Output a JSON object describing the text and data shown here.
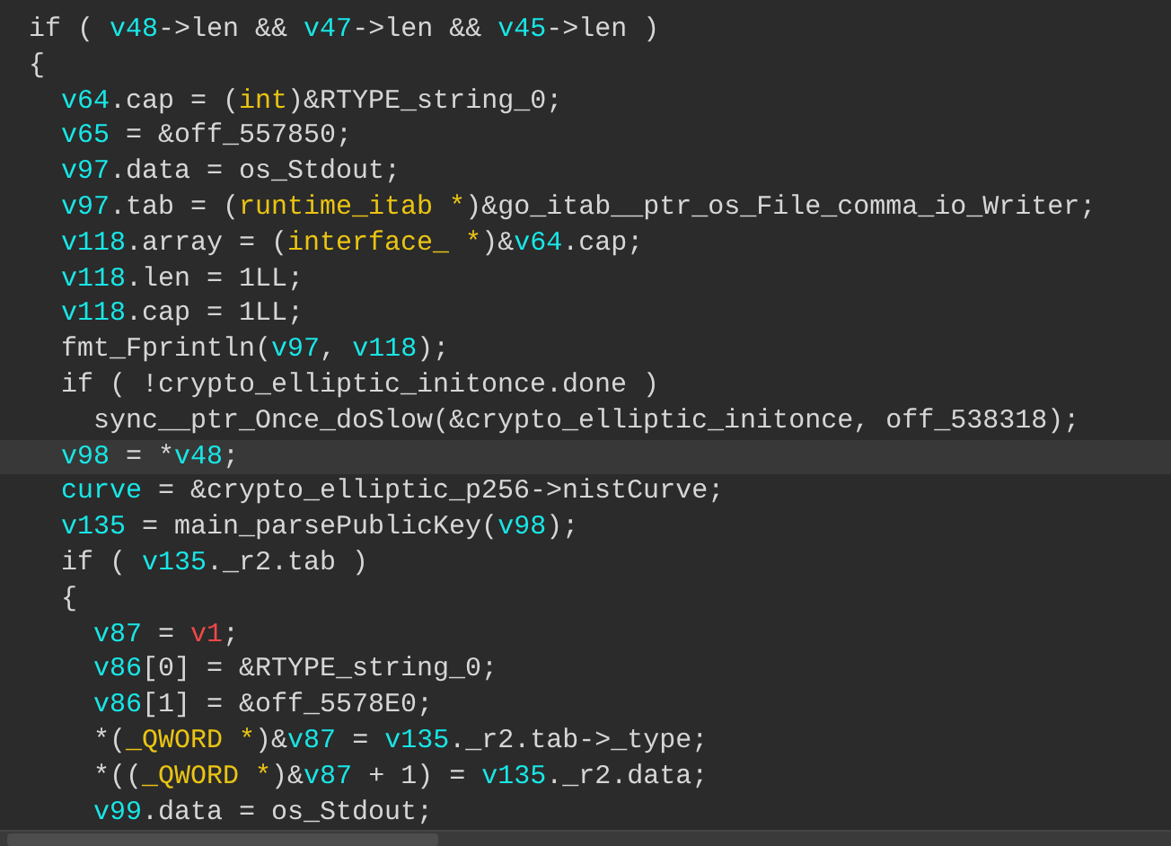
{
  "code_lines": [
    {
      "selected": false,
      "tokens": [
        {
          "text": "if ( ",
          "kind": "plain"
        },
        {
          "text": "v48",
          "kind": "var"
        },
        {
          "text": "->len && ",
          "kind": "plain"
        },
        {
          "text": "v47",
          "kind": "var"
        },
        {
          "text": "->len && ",
          "kind": "plain"
        },
        {
          "text": "v45",
          "kind": "var"
        },
        {
          "text": "->len )",
          "kind": "plain"
        }
      ]
    },
    {
      "selected": false,
      "tokens": [
        {
          "text": "{",
          "kind": "plain"
        }
      ],
      "children": [
        {
          "selected": false,
          "tokens": [
            {
              "text": "v64",
              "kind": "var"
            },
            {
              "text": ".cap = (",
              "kind": "plain"
            },
            {
              "text": "int",
              "kind": "type"
            },
            {
              "text": ")&RTYPE_string_0;",
              "kind": "plain"
            }
          ]
        },
        {
          "selected": false,
          "tokens": [
            {
              "text": "v65",
              "kind": "var"
            },
            {
              "text": " = &off_557850;",
              "kind": "plain"
            }
          ]
        },
        {
          "selected": false,
          "tokens": [
            {
              "text": "v97",
              "kind": "var"
            },
            {
              "text": ".data = os_Stdout;",
              "kind": "plain"
            }
          ]
        },
        {
          "selected": false,
          "tokens": [
            {
              "text": "v97",
              "kind": "var"
            },
            {
              "text": ".tab = (",
              "kind": "plain"
            },
            {
              "text": "runtime_itab *",
              "kind": "type"
            },
            {
              "text": ")&go_itab__ptr_os_File_comma_io_Writer;",
              "kind": "plain"
            }
          ]
        },
        {
          "selected": false,
          "tokens": [
            {
              "text": "v118",
              "kind": "var"
            },
            {
              "text": ".array = (",
              "kind": "plain"
            },
            {
              "text": "interface_ *",
              "kind": "type"
            },
            {
              "text": ")&",
              "kind": "plain"
            },
            {
              "text": "v64",
              "kind": "var"
            },
            {
              "text": ".cap;",
              "kind": "plain"
            }
          ]
        },
        {
          "selected": false,
          "tokens": [
            {
              "text": "v118",
              "kind": "var"
            },
            {
              "text": ".len = 1LL;",
              "kind": "plain"
            }
          ]
        },
        {
          "selected": false,
          "tokens": [
            {
              "text": "v118",
              "kind": "var"
            },
            {
              "text": ".cap = 1LL;",
              "kind": "plain"
            }
          ]
        },
        {
          "selected": false,
          "tokens": [
            {
              "text": "fmt_Fprintln(",
              "kind": "plain"
            },
            {
              "text": "v97",
              "kind": "var"
            },
            {
              "text": ", ",
              "kind": "plain"
            },
            {
              "text": "v118",
              "kind": "var"
            },
            {
              "text": ");",
              "kind": "plain"
            }
          ]
        },
        {
          "selected": false,
          "tokens": [
            {
              "text": "if ( !crypto_elliptic_initonce.done )",
              "kind": "plain"
            }
          ],
          "children": [
            {
              "selected": false,
              "tokens": [
                {
                  "text": "sync__ptr_Once_doSlow(&crypto_elliptic_initonce, off_538318);",
                  "kind": "plain"
                }
              ]
            }
          ]
        },
        {
          "selected": true,
          "tokens": [
            {
              "text": "v98",
              "kind": "var"
            },
            {
              "text": " = *",
              "kind": "plain"
            },
            {
              "text": "v48",
              "kind": "var"
            },
            {
              "text": ";",
              "kind": "plain"
            }
          ]
        },
        {
          "selected": false,
          "tokens": [
            {
              "text": "curve",
              "kind": "var"
            },
            {
              "text": " = &crypto_elliptic_p256->nistCurve;",
              "kind": "plain"
            }
          ]
        },
        {
          "selected": false,
          "tokens": [
            {
              "text": "v135",
              "kind": "var"
            },
            {
              "text": " = main_parsePublicKey(",
              "kind": "plain"
            },
            {
              "text": "v98",
              "kind": "var"
            },
            {
              "text": ");",
              "kind": "plain"
            }
          ]
        },
        {
          "selected": false,
          "tokens": [
            {
              "text": "if ( ",
              "kind": "plain"
            },
            {
              "text": "v135",
              "kind": "var"
            },
            {
              "text": "._r2.tab )",
              "kind": "plain"
            }
          ]
        },
        {
          "selected": false,
          "tokens": [
            {
              "text": "{",
              "kind": "plain"
            }
          ],
          "children": [
            {
              "selected": false,
              "tokens": [
                {
                  "text": "v87",
                  "kind": "var"
                },
                {
                  "text": " = ",
                  "kind": "plain"
                },
                {
                  "text": "v1",
                  "kind": "red"
                },
                {
                  "text": ";",
                  "kind": "plain"
                }
              ]
            },
            {
              "selected": false,
              "tokens": [
                {
                  "text": "v86",
                  "kind": "var"
                },
                {
                  "text": "[0] = &RTYPE_string_0;",
                  "kind": "plain"
                }
              ]
            },
            {
              "selected": false,
              "tokens": [
                {
                  "text": "v86",
                  "kind": "var"
                },
                {
                  "text": "[1] = &off_5578E0;",
                  "kind": "plain"
                }
              ]
            },
            {
              "selected": false,
              "tokens": [
                {
                  "text": "*(",
                  "kind": "plain"
                },
                {
                  "text": "_QWORD *",
                  "kind": "type"
                },
                {
                  "text": ")&",
                  "kind": "plain"
                },
                {
                  "text": "v87",
                  "kind": "var"
                },
                {
                  "text": " = ",
                  "kind": "plain"
                },
                {
                  "text": "v135",
                  "kind": "var"
                },
                {
                  "text": "._r2.tab->_type;",
                  "kind": "plain"
                }
              ]
            },
            {
              "selected": false,
              "tokens": [
                {
                  "text": "*((",
                  "kind": "plain"
                },
                {
                  "text": "_QWORD *",
                  "kind": "type"
                },
                {
                  "text": ")&",
                  "kind": "plain"
                },
                {
                  "text": "v87",
                  "kind": "var"
                },
                {
                  "text": " + 1) = ",
                  "kind": "plain"
                },
                {
                  "text": "v135",
                  "kind": "var"
                },
                {
                  "text": "._r2.data;",
                  "kind": "plain"
                }
              ]
            },
            {
              "selected": false,
              "tokens": [
                {
                  "text": "v99",
                  "kind": "var"
                },
                {
                  "text": ".data = os_Stdout;",
                  "kind": "plain"
                }
              ]
            }
          ]
        }
      ]
    }
  ]
}
